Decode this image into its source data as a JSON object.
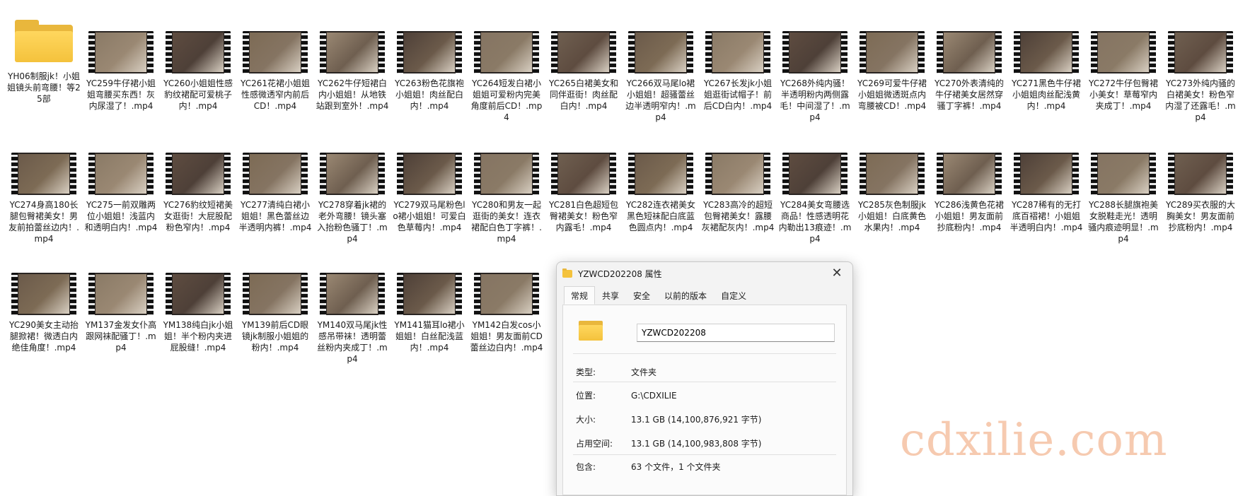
{
  "files": [
    {
      "label": "YH06制服jk！小姐姐镜头前弯腰！等25部",
      "type": "folder"
    },
    {
      "label": "YC259牛仔裙小姐姐弯腰买东西！灰内尿湿了！.mp4",
      "type": "video"
    },
    {
      "label": "YC260小姐姐性感豹纹裙配可爱桃子内！.mp4",
      "type": "video"
    },
    {
      "label": "YC261花裙小姐姐性感微透窄内前后CD！.mp4",
      "type": "video"
    },
    {
      "label": "YC262牛仔短裙白内小姐姐！从地铁站跟到室外！.mp4",
      "type": "video"
    },
    {
      "label": "YC263粉色花旗袍小姐姐！肉丝配白内！.mp4",
      "type": "video"
    },
    {
      "label": "YC264短发白裙小姐姐可爱粉内完美角度前后CD！.mp4",
      "type": "video"
    },
    {
      "label": "YC265白裙美女和同伴逛街！肉丝配白内！.mp4",
      "type": "video"
    },
    {
      "label": "YC266双马尾lo裙小姐姐！超骚蕾丝边半透明窄内！.mp4",
      "type": "video"
    },
    {
      "label": "YC267长发jk小姐姐逛街试帽子！前后CD白内！.mp4",
      "type": "video"
    },
    {
      "label": "YC268外纯内骚！半透明粉内两侧露毛！中间湿了！.mp4",
      "type": "video"
    },
    {
      "label": "YC269可爱牛仔裙小姐姐微透斑点内弯腰被CD！.mp4",
      "type": "video"
    },
    {
      "label": "YC270外表清纯的牛仔裙美女居然穿骚丁字裤！.mp4",
      "type": "video"
    },
    {
      "label": "YC271黑色牛仔裙小姐姐肉丝配浅黄内！.mp4",
      "type": "video"
    },
    {
      "label": "YC272牛仔包臀裙小美女！草莓窄内夹成丁！.mp4",
      "type": "video"
    },
    {
      "label": "YC273外纯内骚的白裙美女！粉色窄内湿了还露毛！.mp4",
      "type": "video"
    },
    {
      "label": "YC274身高180长腿包臀裙美女！男友前拍蕾丝边内！.mp4",
      "type": "video"
    },
    {
      "label": "YC275一前双雕两位小姐姐！浅蓝内和透明白内！.mp4",
      "type": "video"
    },
    {
      "label": "YC276豹纹短裙美女逛街！大屁股配粉色窄内！.mp4",
      "type": "video"
    },
    {
      "label": "YC277清纯白裙小姐姐！黑色蕾丝边半透明内裤！.mp4",
      "type": "video"
    },
    {
      "label": "YC278穿着jk裙的老外弯腰！镜头塞入抬粉色骚丁！.mp4",
      "type": "video"
    },
    {
      "label": "YC279双马尾粉色lo裙小姐姐！可爱白色草莓内！.mp4",
      "type": "video"
    },
    {
      "label": "YC280和男友一起逛街的美女！连衣裙配白色丁字裤！.mp4",
      "type": "video"
    },
    {
      "label": "YC281白色超短包臀裙美女！粉色窄内露毛！.mp4",
      "type": "video"
    },
    {
      "label": "YC282连衣裙美女黑色短袜配白底蓝色圆点内！.mp4",
      "type": "video"
    },
    {
      "label": "YC283高冷的超短包臀裙美女！露腰灰裙配灰内！.mp4",
      "type": "video"
    },
    {
      "label": "YC284美女弯腰选商品！性感透明花内勒出13痕迹！.mp4",
      "type": "video"
    },
    {
      "label": "YC285灰色制服jk小姐姐！白底黄色水果内！.mp4",
      "type": "video"
    },
    {
      "label": "YC286浅黄色花裙小姐姐！男友面前抄底粉内！.mp4",
      "type": "video"
    },
    {
      "label": "YC287稀有的无打底百褶裙！小姐姐半透明白内！.mp4",
      "type": "video"
    },
    {
      "label": "YC288长腿旗袍美女脱鞋走光！透明骚内痕迹明显！.mp4",
      "type": "video"
    },
    {
      "label": "YC289买衣服的大胸美女！男友面前抄底粉内！.mp4",
      "type": "video"
    },
    {
      "label": "YC290美女主动抬腿掀裙！微透白内绝佳角度！.mp4",
      "type": "video"
    },
    {
      "label": "YM137金发女仆高跟网袜配骚丁！.mp4",
      "type": "video"
    },
    {
      "label": "YM138纯白jk小姐姐！半个粉内夹进屁股缝！.mp4",
      "type": "video"
    },
    {
      "label": "YM139前后CD眼镜jk制服小姐姐的粉内！.mp4",
      "type": "video"
    },
    {
      "label": "YM140双马尾jk性感吊带袜！透明蕾丝粉内夹成丁！.mp4",
      "type": "video"
    },
    {
      "label": "YM141猫耳lo裙小姐姐！白丝配浅蓝内！.mp4",
      "type": "video"
    },
    {
      "label": "YM142白发cos小姐姐！男友面前CD蕾丝边白内！.mp4",
      "type": "video"
    }
  ],
  "dialog": {
    "title": "YZWCD202208 属性",
    "close_glyph": "✕",
    "tabs": [
      "常规",
      "共享",
      "安全",
      "以前的版本",
      "自定义"
    ],
    "folder_name": "YZWCD202208",
    "rows": [
      {
        "key": "类型:",
        "value": "文件夹"
      },
      {
        "key": "位置:",
        "value": "G:\\CDXILIE"
      },
      {
        "key": "大小:",
        "value": "13.1 GB (14,100,876,921 字节)"
      },
      {
        "key": "占用空间:",
        "value": "13.1 GB (14,100,983,808 字节)"
      },
      {
        "key": "包含:",
        "value": "63 个文件，1 个文件夹"
      }
    ]
  },
  "watermark": "cdxilie.com",
  "colors": {
    "folder": "#f4c23c",
    "dialog_bg": "#f3f3f3",
    "watermark": "#f0a070"
  }
}
